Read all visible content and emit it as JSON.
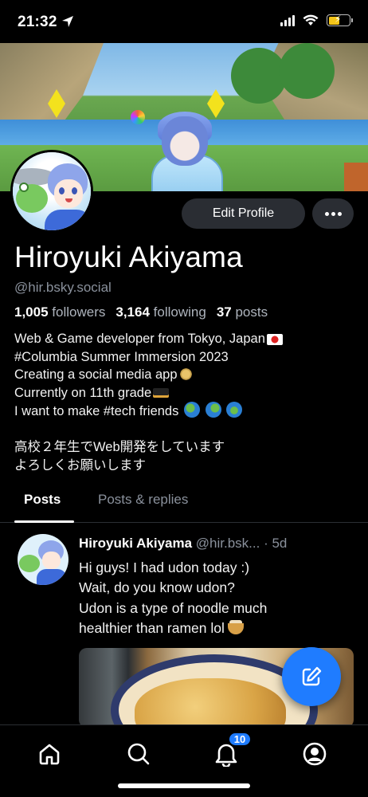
{
  "status_bar": {
    "time": "21:32"
  },
  "profile": {
    "display_name": "Hiroyuki Akiyama",
    "handle": "@hir.bsky.social",
    "edit_button": "Edit Profile",
    "followers_count": "1,005",
    "followers_label": "followers",
    "following_count": "3,164",
    "following_label": "following",
    "posts_count": "37",
    "posts_label": "posts",
    "bio_lines": [
      "Web & Game developer from Tokyo, Japan",
      "#Columbia Summer Immersion 2023",
      "Creating a social media app",
      "Currently on 11th grade",
      "I want to make #tech friends",
      "高校２年生でWeb開発をしています",
      "よろしくお願いします"
    ]
  },
  "tabs": [
    {
      "label": "Posts",
      "active": true
    },
    {
      "label": "Posts & replies",
      "active": false
    }
  ],
  "post": {
    "author": "Hiroyuki Akiyama",
    "handle": "@hir.bsk...",
    "time": "· 5d",
    "text_lines": [
      "Hi guys! I had udon today :)",
      "Wait, do you know udon?",
      "Udon is a type of noodle much",
      "healthier than ramen lol"
    ]
  },
  "bottom_nav": {
    "items": [
      "home-icon",
      "search-icon",
      "notifications-icon",
      "profile-icon"
    ],
    "notifications_badge": "10"
  },
  "colors": {
    "accent": "#1f7cff",
    "background": "#000000",
    "button_bg": "#2a2d33",
    "muted_text": "#8a919c"
  }
}
